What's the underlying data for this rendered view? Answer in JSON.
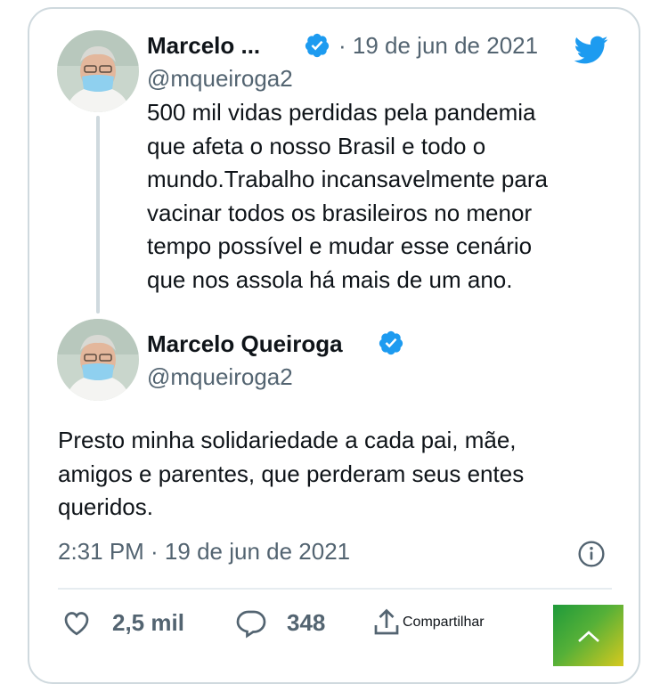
{
  "quoted_tweet": {
    "author_name": "Marcelo ...",
    "handle": "@mqueiroga2",
    "date": "· 19 de jun de 2021",
    "text_lines": [
      "500 mil vidas perdidas pela pandemia",
      "que afeta o nosso Brasil e todo o",
      "mundo.Trabalho incansavelmente para",
      "vacinar todos os brasileiros no menor",
      "tempo possível e mudar esse cenário",
      "que nos assola há mais de um ano."
    ]
  },
  "main_tweet": {
    "author_name": "Marcelo Queiroga",
    "handle": "@mqueiroga2",
    "text_lines": [
      "Presto minha solidariedade a cada pai, mãe,",
      "amigos e parentes, que perderam seus entes",
      "queridos."
    ],
    "timestamp": "2:31 PM · 19 de jun de 2021"
  },
  "actions": {
    "likes": "2,5 mil",
    "replies": "348",
    "share_label": "Compartilhar"
  },
  "icons": {
    "verified": "verified-badge-icon",
    "twitter": "twitter-bird-icon",
    "info": "info-icon",
    "like": "heart-icon",
    "reply": "speech-bubble-icon",
    "share": "share-icon",
    "scroll_top": "chevron-up-icon"
  },
  "colors": {
    "twitter_blue": "#1d9bf0",
    "text_primary": "#0f1419",
    "text_secondary": "#536471",
    "border": "#cfd9de"
  }
}
